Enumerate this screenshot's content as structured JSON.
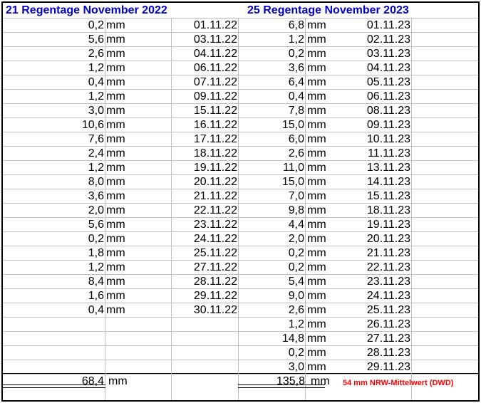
{
  "header": {
    "left_title": "21 Regentage November 2022",
    "right_title": "25 Regentage November 2023"
  },
  "unit": "mm",
  "rows_2022": [
    {
      "value": "0,2",
      "date": "01.11.22"
    },
    {
      "value": "5,6",
      "date": "03.11.22"
    },
    {
      "value": "2,6",
      "date": "04.11.22"
    },
    {
      "value": "1,2",
      "date": "06.11.22"
    },
    {
      "value": "0,4",
      "date": "07.11.22"
    },
    {
      "value": "1,2",
      "date": "09.11.22"
    },
    {
      "value": "3,0",
      "date": "15.11.22"
    },
    {
      "value": "10,6",
      "date": "16.11.22"
    },
    {
      "value": "7,6",
      "date": "17.11.22"
    },
    {
      "value": "2,4",
      "date": "18.11.22"
    },
    {
      "value": "1,2",
      "date": "19.11.22"
    },
    {
      "value": "8,0",
      "date": "20.11.22"
    },
    {
      "value": "3,6",
      "date": "21.11.22"
    },
    {
      "value": "2,0",
      "date": "22.11.22"
    },
    {
      "value": "5,6",
      "date": "23.11.22"
    },
    {
      "value": "0,2",
      "date": "24.11.22"
    },
    {
      "value": "1,8",
      "date": "25.11.22"
    },
    {
      "value": "1,2",
      "date": "27.11.22"
    },
    {
      "value": "8,4",
      "date": "28.11.22"
    },
    {
      "value": "1,6",
      "date": "29.11.22"
    },
    {
      "value": "0,4",
      "date": "30.11.22"
    }
  ],
  "rows_2023": [
    {
      "value": "6,8",
      "date": "01.11.23"
    },
    {
      "value": "1,2",
      "date": "02.11.23"
    },
    {
      "value": "0,2",
      "date": "03.11.23"
    },
    {
      "value": "3,6",
      "date": "04.11.23"
    },
    {
      "value": "6,4",
      "date": "05.11.23"
    },
    {
      "value": "0,4",
      "date": "06.11.23"
    },
    {
      "value": "7,8",
      "date": "08.11.23"
    },
    {
      "value": "15,0",
      "date": "09.11.23"
    },
    {
      "value": "6,0",
      "date": "10.11.23"
    },
    {
      "value": "2,6",
      "date": "11.11.23"
    },
    {
      "value": "11,0",
      "date": "13.11.23"
    },
    {
      "value": "15,0",
      "date": "14.11.23"
    },
    {
      "value": "7,0",
      "date": "15.11.23"
    },
    {
      "value": "9,8",
      "date": "18.11.23"
    },
    {
      "value": "4,4",
      "date": "19.11.23"
    },
    {
      "value": "2,0",
      "date": "20.11.23"
    },
    {
      "value": "0,2",
      "date": "21.11.23"
    },
    {
      "value": "0,2",
      "date": "22.11.23"
    },
    {
      "value": "5,4",
      "date": "23.11.23"
    },
    {
      "value": "9,0",
      "date": "24.11.23"
    },
    {
      "value": "2,6",
      "date": "25.11.23"
    },
    {
      "value": "1,2",
      "date": "26.11.23"
    },
    {
      "value": "14,8",
      "date": "27.11.23"
    },
    {
      "value": "0,2",
      "date": "28.11.23"
    },
    {
      "value": "3,0",
      "date": "29.11.23"
    }
  ],
  "totals": {
    "total_2022": "68,4",
    "total_2023": "135,8",
    "note": "54 mm NRW-Mittelwert (DWD)"
  },
  "colors": {
    "title": "#0000cc",
    "note": "#ff0000",
    "grid": "#c0c0c0"
  }
}
